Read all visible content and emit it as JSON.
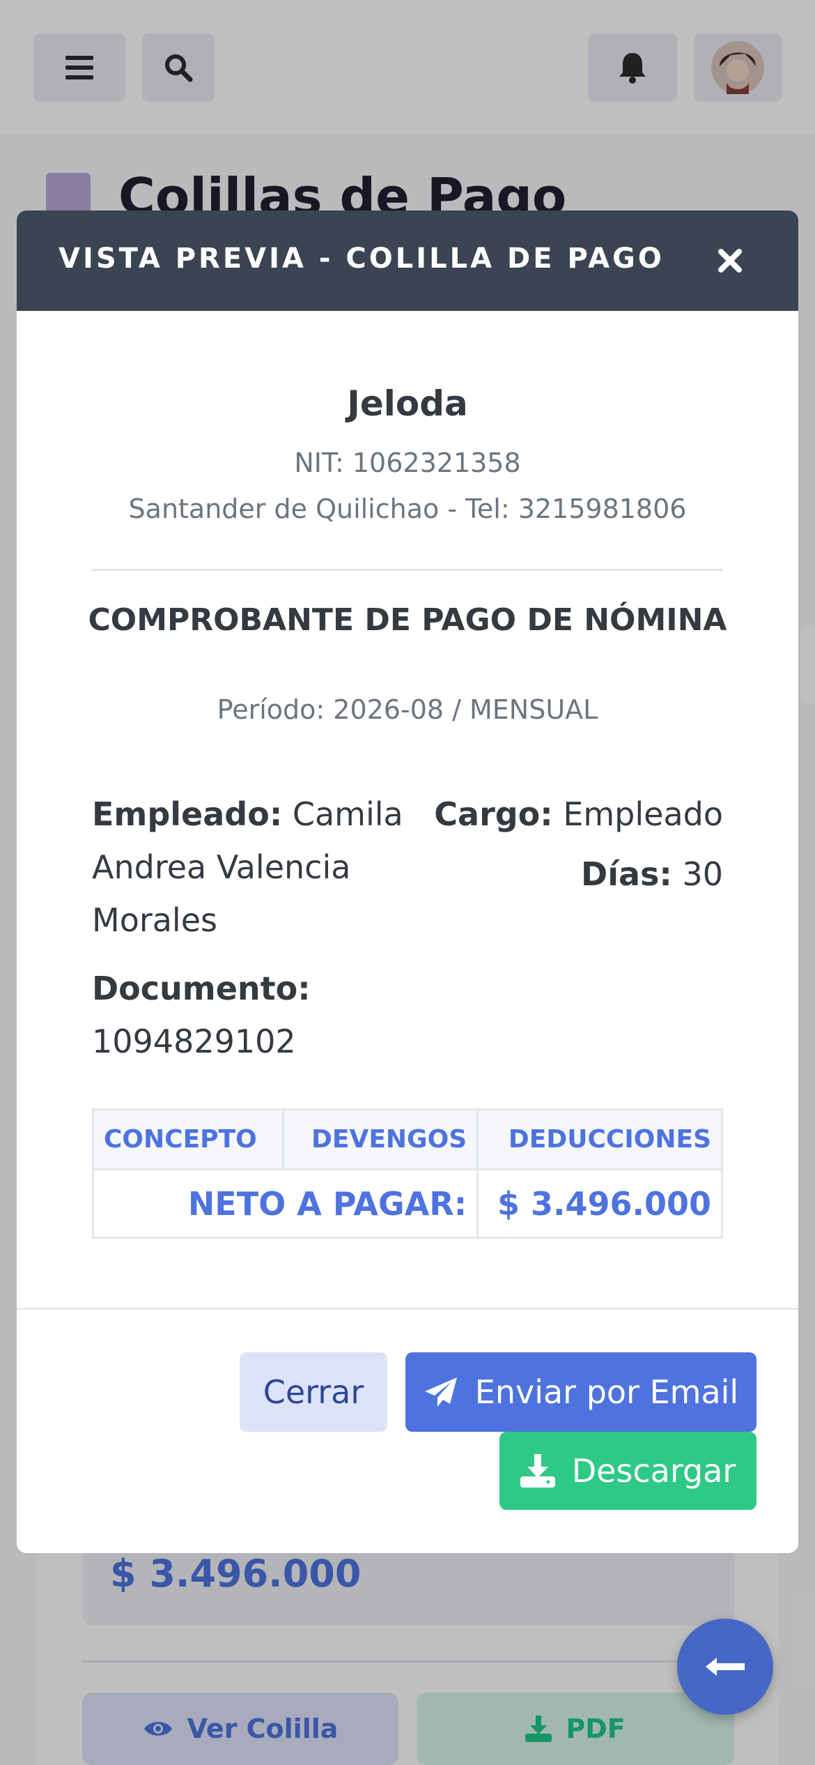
{
  "background": {
    "page_title": "Colillas de Pago",
    "amount": "$ 3.496.000",
    "ver_colilla_label": "Ver Colilla",
    "pdf_label": "PDF"
  },
  "modal": {
    "title": "VISTA PREVIA - COLILLA DE PAGO",
    "company": {
      "name": "Jeloda",
      "nit": "NIT: 1062321358",
      "address_phone": "Santander de Quilichao - Tel: 3215981806"
    },
    "document_title": "COMPROBANTE DE PAGO DE NÓMINA",
    "period": "Período: 2026-08 / MENSUAL",
    "employee": {
      "label": "Empleado:",
      "value": "Camila Andrea Valencia Morales"
    },
    "document": {
      "label": "Documento:",
      "value": "1094829102"
    },
    "position": {
      "label": "Cargo:",
      "value": "Empleado"
    },
    "days": {
      "label": "Días:",
      "value": "30"
    },
    "table": {
      "headers": [
        "CONCEPTO",
        "DEVENGOS",
        "DEDUCCIONES"
      ],
      "net_label": "NETO A PAGAR:",
      "net_value": "$ 3.496.000"
    },
    "buttons": {
      "close": "Cerrar",
      "email": "Enviar por Email",
      "download": "Descargar"
    }
  },
  "colors": {
    "header_bg": "#3a4452",
    "primary": "#4e73df",
    "success": "#2fc987",
    "close_bg": "#dce3f8"
  }
}
